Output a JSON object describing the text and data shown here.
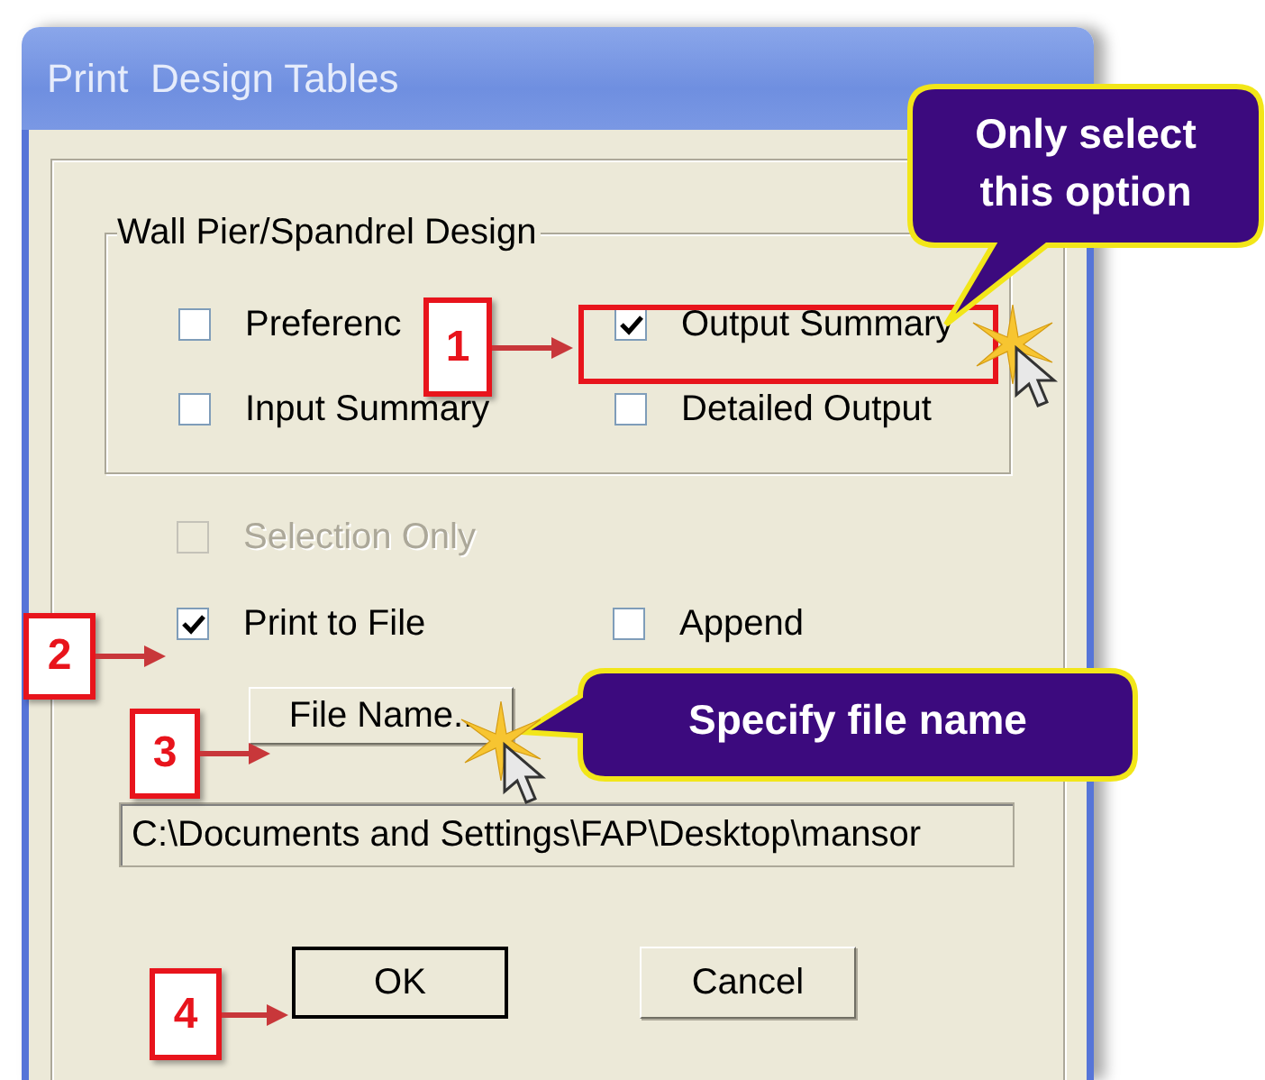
{
  "window": {
    "title": "Print  Design Tables"
  },
  "group": {
    "title": "Wall Pier/Spandrel Design",
    "options": [
      {
        "label": "Preferenc",
        "checked": false,
        "highlighted": false
      },
      {
        "label": "Output Summary",
        "checked": true,
        "highlighted": true
      },
      {
        "label": "Input Summary",
        "checked": false,
        "highlighted": false
      },
      {
        "label": "Detailed Output",
        "checked": false,
        "highlighted": false
      }
    ]
  },
  "options": [
    {
      "label": "Selection Only",
      "checked": false,
      "disabled": true
    },
    {
      "label": "Print to File",
      "checked": true,
      "disabled": false
    },
    {
      "label": "Append",
      "checked": false,
      "disabled": false
    }
  ],
  "file_name_button": "File Name..",
  "path_field": {
    "value": "C:\\Documents and Settings\\FAP\\Desktop\\mansor"
  },
  "buttons": [
    {
      "label": "OK",
      "default": true
    },
    {
      "label": "Cancel",
      "default": false
    }
  ],
  "annotations": {
    "steps": [
      "1",
      "2",
      "3",
      "4"
    ],
    "callouts": [
      "Only select this option",
      "Specify file name"
    ]
  }
}
